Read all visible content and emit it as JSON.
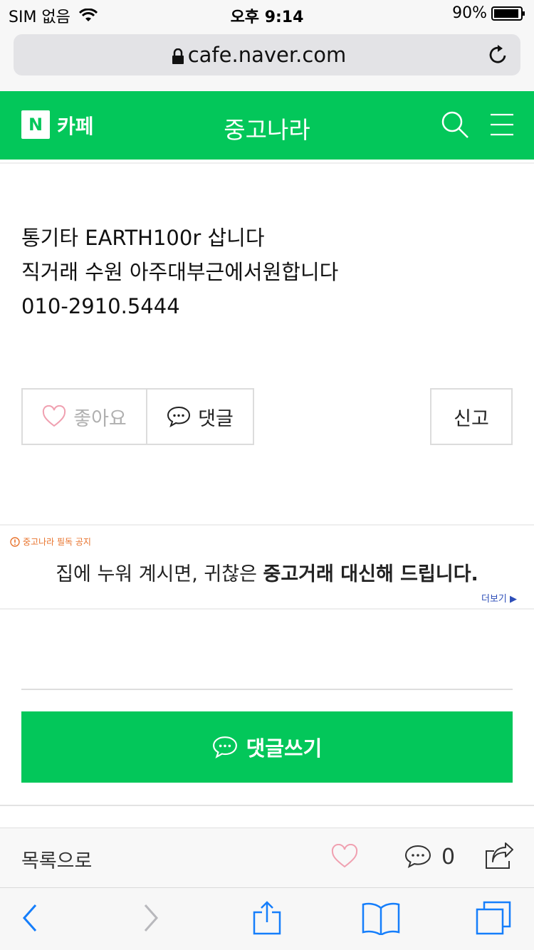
{
  "status_bar": {
    "carrier": "SIM 없음",
    "time": "오후 9:14",
    "battery": "90%"
  },
  "browser": {
    "url": "cafe.naver.com"
  },
  "header": {
    "logo_letter": "N",
    "cafe_label": "카페",
    "cafe_name": "중고나라"
  },
  "post": {
    "lines": [
      "통기타 EARTH100r 삽니다",
      "직거래 수원 아주대부근에서원합니다",
      "010-2910.5444"
    ]
  },
  "actions": {
    "like_label": "좋아요",
    "comment_label": "댓글",
    "report_label": "신고"
  },
  "notice": {
    "tag": "중고나라 필독 공지",
    "text_normal": "집에 누워 계시면, 귀찮은 ",
    "text_bold": "중고거래 대신해 드립니다.",
    "more": "더보기 ▶"
  },
  "comment_area": {
    "write_label": "댓글쓰기"
  },
  "bottom_bar": {
    "list_label": "목록으로",
    "comment_count": "0"
  },
  "colors": {
    "brand_green": "#03c75a",
    "ios_blue": "#157efb",
    "notice_orange": "#e8722b"
  }
}
